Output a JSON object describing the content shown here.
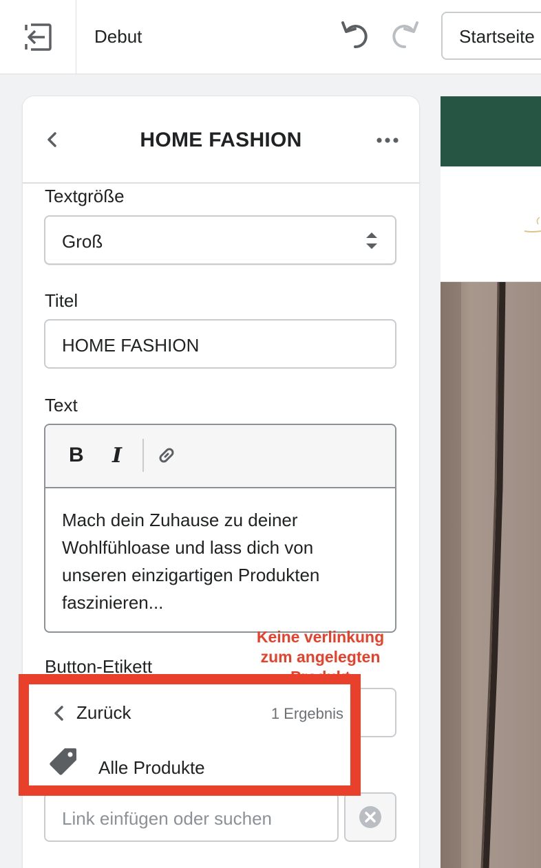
{
  "topbar": {
    "theme_name": "Debut",
    "page_select_value": "Startseite"
  },
  "panel": {
    "title": "HOME FASHION",
    "text_size": {
      "label": "Textgröße",
      "value": "Groß"
    },
    "title_field": {
      "label": "Titel",
      "value": "HOME FASHION"
    },
    "text_field": {
      "label": "Text",
      "toolbar": {
        "bold": "B",
        "italic": "I"
      },
      "content": "Mach dein Zuhause zu deiner Wohlfühloase und lass dich von unseren einzigartigen Produkten faszinieren..."
    },
    "button_label": {
      "label": "Button-Etikett"
    },
    "link_field": {
      "placeholder": "Link einfügen oder suchen"
    }
  },
  "dropdown": {
    "back_label": "Zurück",
    "result_count": "1 Ergebnis",
    "items": [
      {
        "label": "Alle Produkte",
        "icon": "tag-icon"
      }
    ]
  },
  "annotation": {
    "line1": "Keine verlinkung",
    "line2": "zum angelegten",
    "line3": "Produkt"
  },
  "colors": {
    "highlight": "#e8402a",
    "preview_bar": "#275543"
  }
}
